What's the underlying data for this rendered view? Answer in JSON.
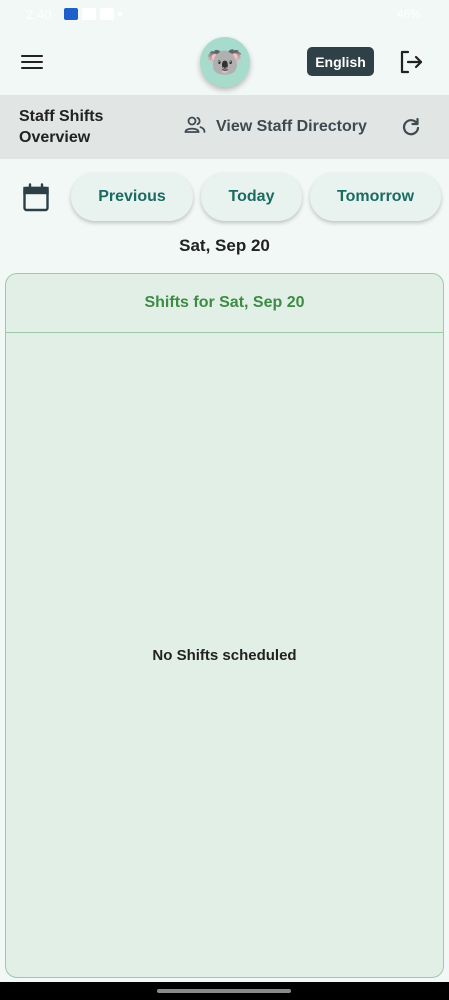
{
  "status_bar": {
    "time": "2:40",
    "battery": "46%"
  },
  "app_bar": {
    "logo_emoji": "🐨",
    "language_label": "English"
  },
  "toolbar": {
    "title": "Staff Shifts Overview",
    "directory_label": "View Staff Directory"
  },
  "date_nav": {
    "previous_label": "Previous",
    "today_label": "Today",
    "tomorrow_label": "Tomorrow",
    "current_date": "Sat, Sep 20"
  },
  "shifts_card": {
    "header": "Shifts for Sat, Sep 20",
    "empty_message": "No Shifts scheduled"
  },
  "colors": {
    "accent_teal": "#1c6b62",
    "accent_green": "#3d8b45",
    "language_button_bg": "#2f4047",
    "card_bg": "#e2efe7"
  },
  "icons": {
    "menu": "hamburger-menu-icon",
    "logout": "logout-icon",
    "directory": "people-icon",
    "refresh": "refresh-icon",
    "calendar": "calendar-icon"
  }
}
